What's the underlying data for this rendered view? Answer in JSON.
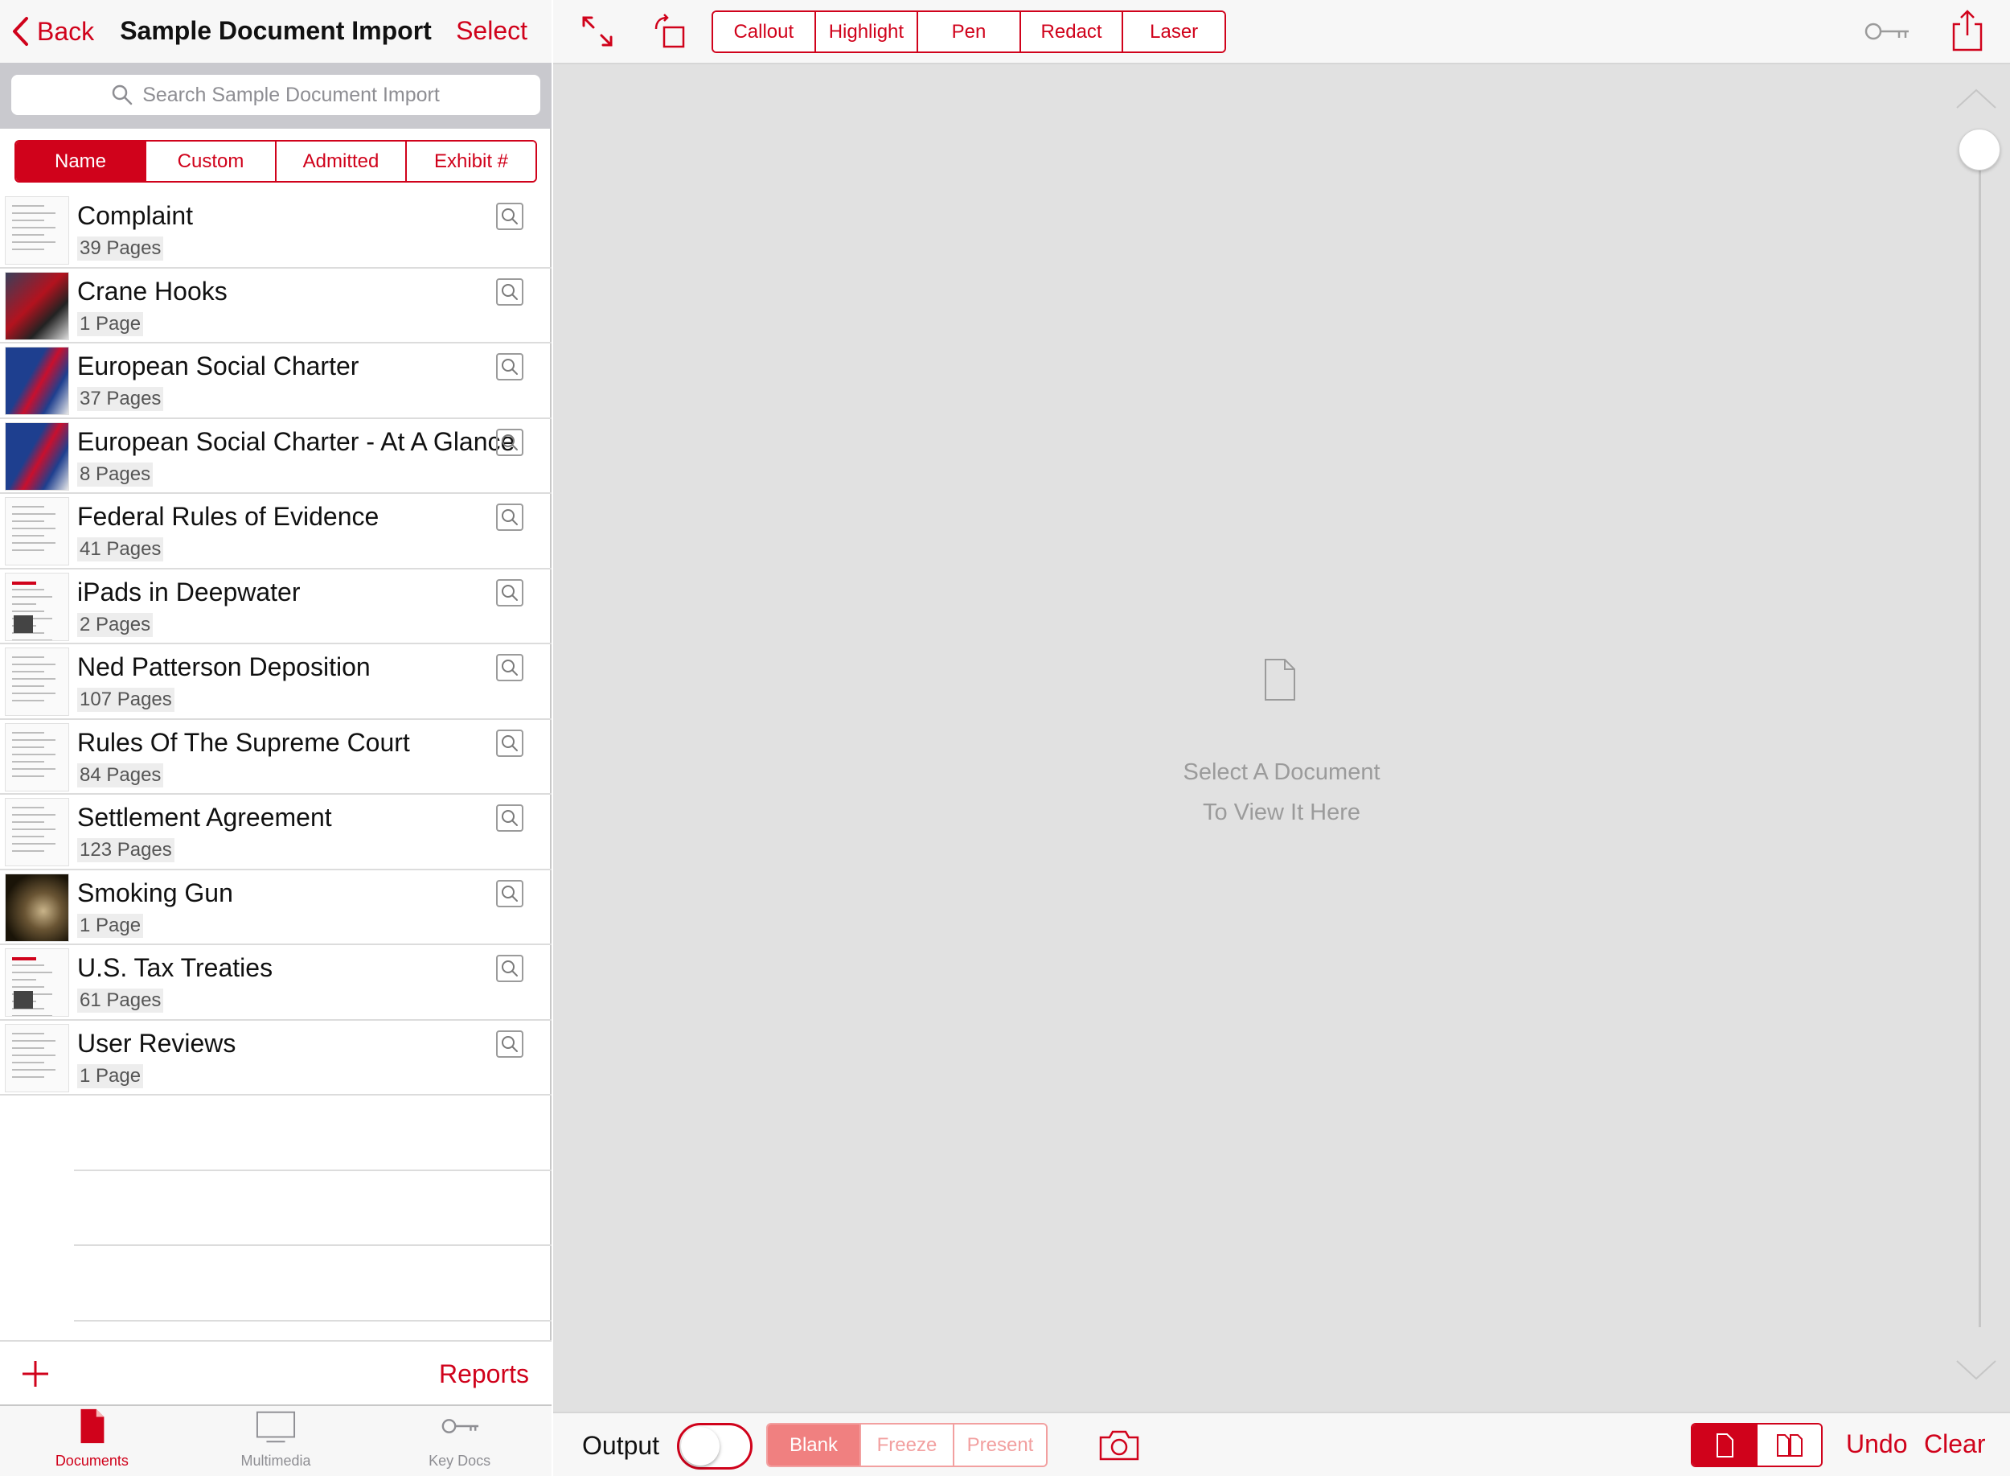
{
  "colors": {
    "accent": "#d0021b",
    "accent_light": "#f08080",
    "viewer_bg": "#e1e1e1"
  },
  "left": {
    "back_label": "Back",
    "title": "Sample Document Import",
    "select_label": "Select",
    "search_placeholder": "Search Sample Document Import",
    "sort_options": [
      "Name",
      "Custom",
      "Admitted",
      "Exhibit #"
    ],
    "sort_selected": "Name",
    "documents": [
      {
        "name": "Complaint",
        "pages": "39 Pages",
        "thumb": "text"
      },
      {
        "name": "Crane Hooks",
        "pages": "1 Page",
        "thumb": "photo-red"
      },
      {
        "name": "European Social Charter",
        "pages": "37 Pages",
        "thumb": "blue-red"
      },
      {
        "name": "European Social Charter - At A Glance",
        "pages": "8 Pages",
        "thumb": "blue-red"
      },
      {
        "name": "Federal Rules of Evidence",
        "pages": "41 Pages",
        "thumb": "text"
      },
      {
        "name": "iPads in Deepwater",
        "pages": "2 Pages",
        "thumb": "news"
      },
      {
        "name": "Ned Patterson Deposition",
        "pages": "107 Pages",
        "thumb": "text"
      },
      {
        "name": "Rules Of The Supreme Court",
        "pages": "84 Pages",
        "thumb": "text"
      },
      {
        "name": "Settlement Agreement",
        "pages": "123 Pages",
        "thumb": "text"
      },
      {
        "name": "Smoking Gun",
        "pages": "1 Page",
        "thumb": "photo-dark"
      },
      {
        "name": "U.S. Tax Treaties",
        "pages": "61 Pages",
        "thumb": "news"
      },
      {
        "name": "User Reviews",
        "pages": "1 Page",
        "thumb": "text"
      }
    ],
    "reports_label": "Reports",
    "tabs": [
      {
        "label": "Documents",
        "icon": "document-icon",
        "active": true
      },
      {
        "label": "Multimedia",
        "icon": "monitor-icon",
        "active": false
      },
      {
        "label": "Key Docs",
        "icon": "key-icon",
        "active": false
      }
    ]
  },
  "toolbar": {
    "annotation_tools": [
      "Callout",
      "Highlight",
      "Pen",
      "Redact",
      "Laser"
    ]
  },
  "viewer": {
    "placeholder_line1": "Select A Document",
    "placeholder_line2": "To View It Here"
  },
  "bottom": {
    "output_label": "Output",
    "output_on": false,
    "modes": [
      "Blank",
      "Freeze",
      "Present"
    ],
    "mode_selected": "Blank",
    "undo_label": "Undo",
    "clear_label": "Clear"
  }
}
